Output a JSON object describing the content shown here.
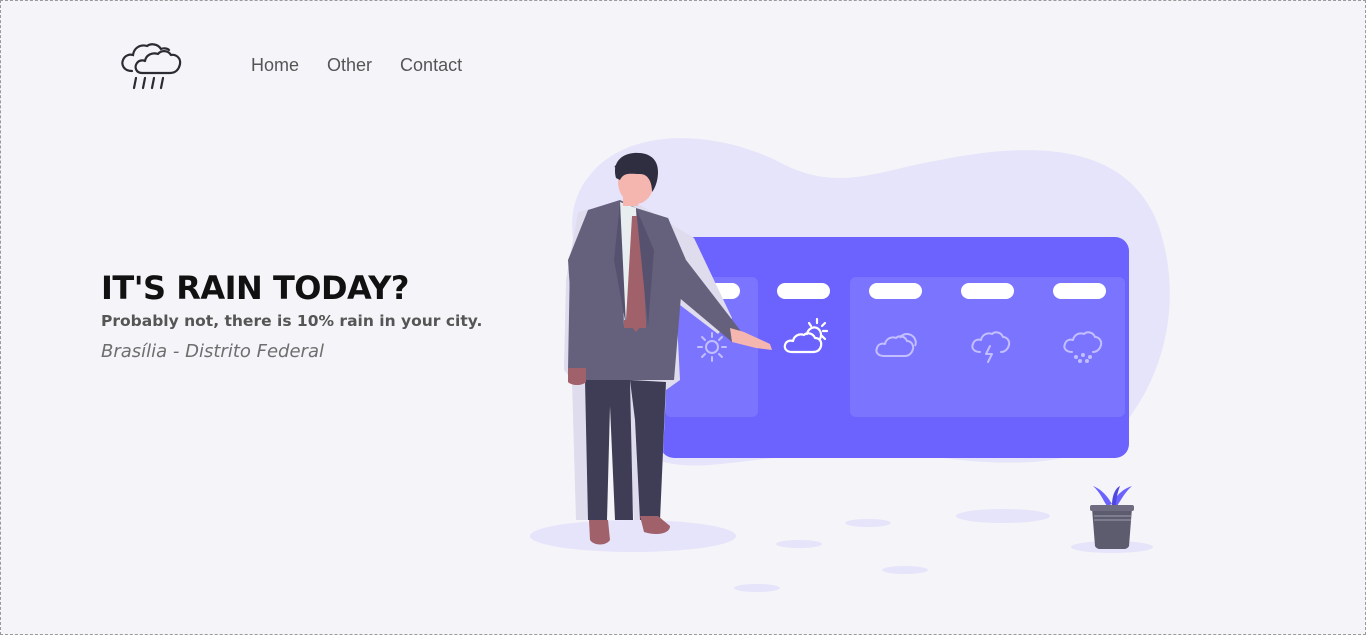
{
  "nav": {
    "items": [
      {
        "label": "Home"
      },
      {
        "label": "Other"
      },
      {
        "label": "Contact"
      }
    ]
  },
  "hero": {
    "title": "IT'S RAIN TODAY?",
    "subtitle": "Probably not, there is 10% rain in your city.",
    "location": "Brasília - Distrito Federal"
  },
  "icons": {
    "logo": "cloud-rain-icon",
    "forecast": [
      "sun-icon",
      "partly-cloudy-icon",
      "cloud-icon",
      "thunderstorm-icon",
      "snow-icon"
    ]
  },
  "colors": {
    "background": "#f5f4f8",
    "accent": "#6c63ff",
    "blob": "#e6e4fa",
    "text_dark": "#111111",
    "text_muted": "#555555"
  }
}
